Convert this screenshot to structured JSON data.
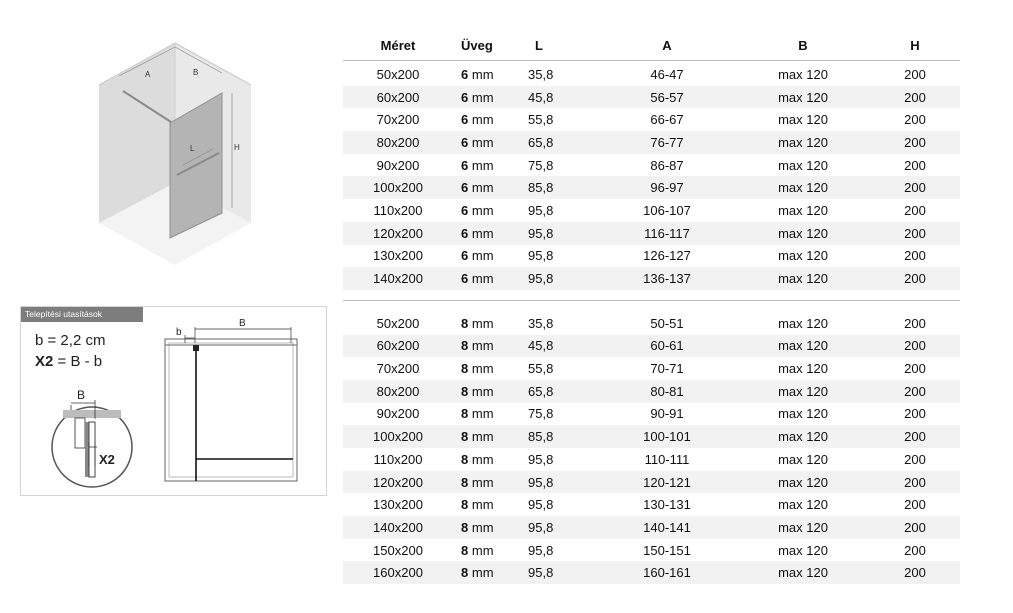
{
  "iso_labels": {
    "a": "A",
    "b": "B",
    "l": "L",
    "h": "H"
  },
  "install": {
    "title": "Telepítési utasítások",
    "formula_b": "b = 2,2 cm",
    "formula_x2_var": "X2",
    "formula_x2_rest": " = B - b",
    "detail_b": "B",
    "detail_x2": "X2",
    "plan_b_small": "b",
    "plan_b_big": "B"
  },
  "table": {
    "headers": [
      "Méret",
      "Üveg",
      "L",
      "A",
      "B",
      "H"
    ],
    "glass_unit": "mm",
    "group1": [
      {
        "size": "50x200",
        "glass": "6",
        "l": "35,8",
        "a": "46-47",
        "b": "max 120",
        "h": "200"
      },
      {
        "size": "60x200",
        "glass": "6",
        "l": "45,8",
        "a": "56-57",
        "b": "max 120",
        "h": "200"
      },
      {
        "size": "70x200",
        "glass": "6",
        "l": "55,8",
        "a": "66-67",
        "b": "max 120",
        "h": "200"
      },
      {
        "size": "80x200",
        "glass": "6",
        "l": "65,8",
        "a": "76-77",
        "b": "max 120",
        "h": "200"
      },
      {
        "size": "90x200",
        "glass": "6",
        "l": "75,8",
        "a": "86-87",
        "b": "max 120",
        "h": "200"
      },
      {
        "size": "100x200",
        "glass": "6",
        "l": "85,8",
        "a": "96-97",
        "b": "max 120",
        "h": "200"
      },
      {
        "size": "110x200",
        "glass": "6",
        "l": "95,8",
        "a": "106-107",
        "b": "max 120",
        "h": "200"
      },
      {
        "size": "120x200",
        "glass": "6",
        "l": "95,8",
        "a": "116-117",
        "b": "max 120",
        "h": "200"
      },
      {
        "size": "130x200",
        "glass": "6",
        "l": "95,8",
        "a": "126-127",
        "b": "max 120",
        "h": "200"
      },
      {
        "size": "140x200",
        "glass": "6",
        "l": "95,8",
        "a": "136-137",
        "b": "max 120",
        "h": "200"
      }
    ],
    "group2": [
      {
        "size": "50x200",
        "glass": "8",
        "l": "35,8",
        "a": "50-51",
        "b": "max 120",
        "h": "200"
      },
      {
        "size": "60x200",
        "glass": "8",
        "l": "45,8",
        "a": "60-61",
        "b": "max 120",
        "h": "200"
      },
      {
        "size": "70x200",
        "glass": "8",
        "l": "55,8",
        "a": "70-71",
        "b": "max 120",
        "h": "200"
      },
      {
        "size": "80x200",
        "glass": "8",
        "l": "65,8",
        "a": "80-81",
        "b": "max 120",
        "h": "200"
      },
      {
        "size": "90x200",
        "glass": "8",
        "l": "75,8",
        "a": "90-91",
        "b": "max 120",
        "h": "200"
      },
      {
        "size": "100x200",
        "glass": "8",
        "l": "85,8",
        "a": "100-101",
        "b": "max 120",
        "h": "200"
      },
      {
        "size": "110x200",
        "glass": "8",
        "l": "95,8",
        "a": "110-111",
        "b": "max 120",
        "h": "200"
      },
      {
        "size": "120x200",
        "glass": "8",
        "l": "95,8",
        "a": "120-121",
        "b": "max 120",
        "h": "200"
      },
      {
        "size": "130x200",
        "glass": "8",
        "l": "95,8",
        "a": "130-131",
        "b": "max 120",
        "h": "200"
      },
      {
        "size": "140x200",
        "glass": "8",
        "l": "95,8",
        "a": "140-141",
        "b": "max 120",
        "h": "200"
      },
      {
        "size": "150x200",
        "glass": "8",
        "l": "95,8",
        "a": "150-151",
        "b": "max 120",
        "h": "200"
      },
      {
        "size": "160x200",
        "glass": "8",
        "l": "95,8",
        "a": "160-161",
        "b": "max 120",
        "h": "200"
      }
    ]
  }
}
